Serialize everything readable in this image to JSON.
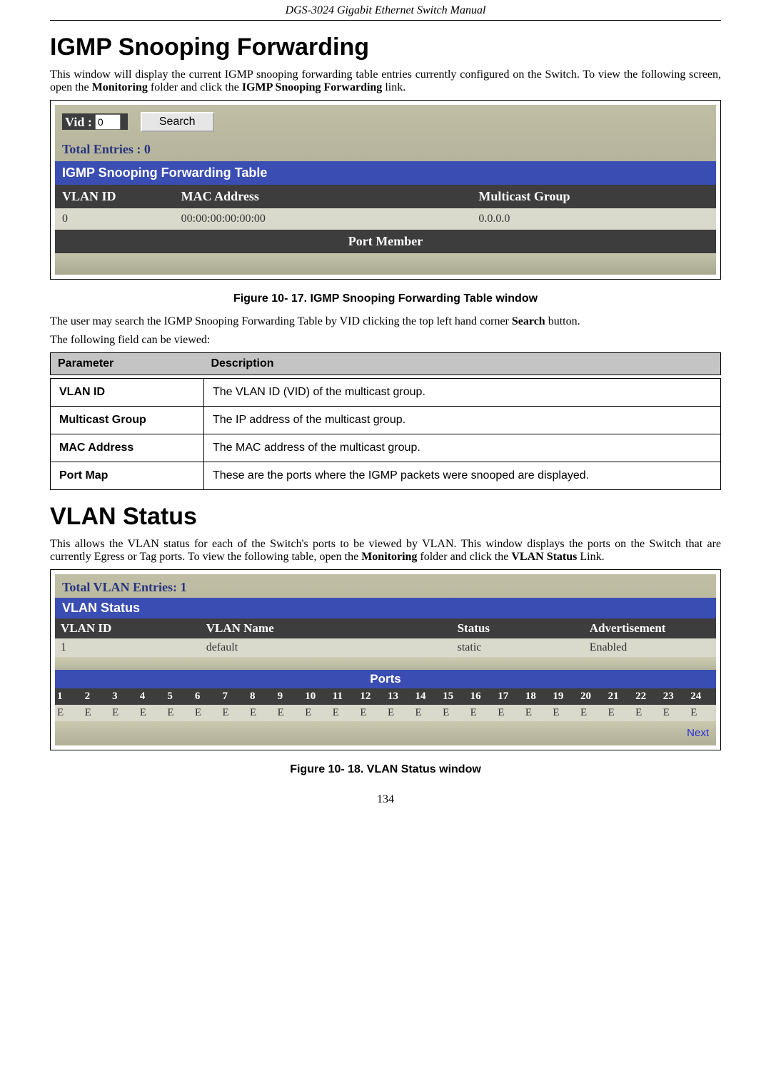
{
  "header": {
    "doc_title": "DGS-3024 Gigabit Ethernet Switch Manual"
  },
  "igmp": {
    "heading": "IGMP Snooping Forwarding",
    "intro_a": "This window will display the current IGMP snooping forwarding table entries currently configured on the Switch. To view the following screen, open the ",
    "intro_b": "Monitoring",
    "intro_c": " folder and click the ",
    "intro_d": "IGMP Snooping Forwarding",
    "intro_e": " link.",
    "vid_label": "Vid :",
    "vid_value": "0",
    "search_label": "Search",
    "total_entries": "Total Entries : 0",
    "table_title": "IGMP Snooping Forwarding Table",
    "cols": {
      "vlan_id": "VLAN ID",
      "mac": "MAC Address",
      "mgroup": "Multicast Group"
    },
    "row": {
      "vlan_id": "0",
      "mac": "00:00:00:00:00:00",
      "mgroup": "0.0.0.0"
    },
    "port_member": "Port Member",
    "caption": "Figure 10- 17. IGMP Snooping Forwarding Table window",
    "after1_a": "The user may search the IGMP Snooping Forwarding Table by VID clicking the top left hand corner ",
    "after1_b": "Search",
    "after1_c": " button.",
    "after2": "The following field can be viewed:"
  },
  "params": {
    "hdr_param": "Parameter",
    "hdr_desc": "Description",
    "rows": [
      {
        "label": "VLAN ID",
        "desc": "The VLAN ID (VID) of the multicast group."
      },
      {
        "label": "Multicast Group",
        "desc": "The IP address of the multicast group."
      },
      {
        "label": "MAC Address",
        "desc": "The MAC address of the multicast group."
      },
      {
        "label": "Port Map",
        "desc": "These are the ports where the IGMP packets were snooped are displayed."
      }
    ]
  },
  "vlan": {
    "heading": "VLAN Status",
    "intro_a": "This allows the VLAN status for each of the Switch's ports to be viewed by VLAN. This window displays the ports on the Switch that are currently Egress or Tag ports. To view the following table, open the ",
    "intro_b": "Monitoring",
    "intro_c": " folder and click the ",
    "intro_d": "VLAN Status",
    "intro_e": " Link.",
    "total_entries": "Total VLAN Entries: 1",
    "status_title": "VLAN Status",
    "meta": {
      "cols": {
        "vlan_id": "VLAN ID",
        "vlan_name": "VLAN Name",
        "status": "Status",
        "adv": "Advertisement"
      },
      "row": {
        "vlan_id": "1",
        "vlan_name": "default",
        "status": "static",
        "adv": "Enabled"
      }
    },
    "ports_label": "Ports",
    "port_headers": [
      "1",
      "2",
      "3",
      "4",
      "5",
      "6",
      "7",
      "8",
      "9",
      "10",
      "11",
      "12",
      "13",
      "14",
      "15",
      "16",
      "17",
      "18",
      "19",
      "20",
      "21",
      "22",
      "23",
      "24"
    ],
    "port_values": [
      "E",
      "E",
      "E",
      "E",
      "E",
      "E",
      "E",
      "E",
      "E",
      "E",
      "E",
      "E",
      "E",
      "E",
      "E",
      "E",
      "E",
      "E",
      "E",
      "E",
      "E",
      "E",
      "E",
      "E"
    ],
    "next_label": "Next",
    "caption": "Figure 10- 18. VLAN Status window"
  },
  "page_number": "134"
}
